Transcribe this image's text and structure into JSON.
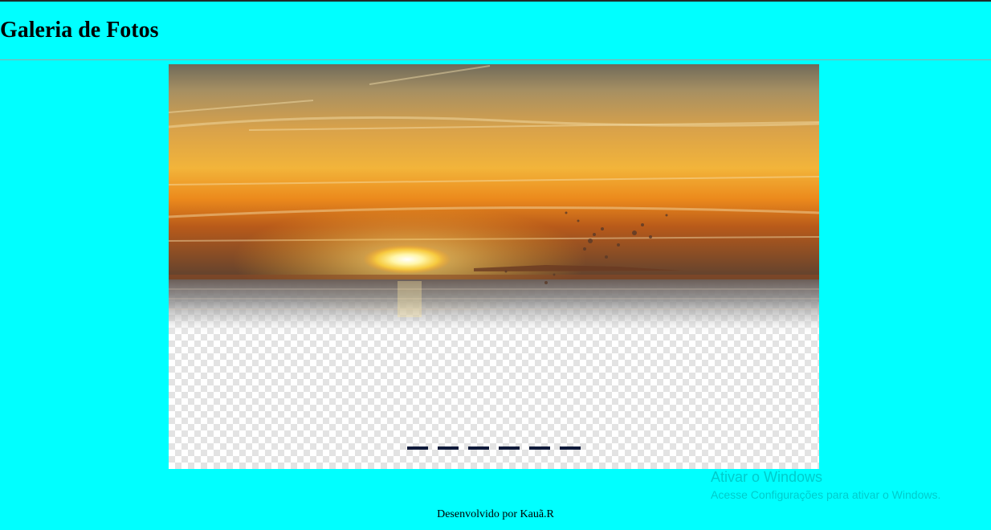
{
  "header": {
    "title": "Galeria de Fotos"
  },
  "carousel": {
    "image_icon": "sunset-over-sea-photo",
    "slide_count": 6,
    "active_slide": 1,
    "indicator_color": "#0f1a3a"
  },
  "watermark": {
    "title": "Ativar o Windows",
    "subtitle": "Acesse Configurações para ativar o Windows."
  },
  "footer": {
    "text": "Desenvolvido por Kauã.R"
  },
  "colors": {
    "background": "#00ffff",
    "text": "#000000"
  }
}
